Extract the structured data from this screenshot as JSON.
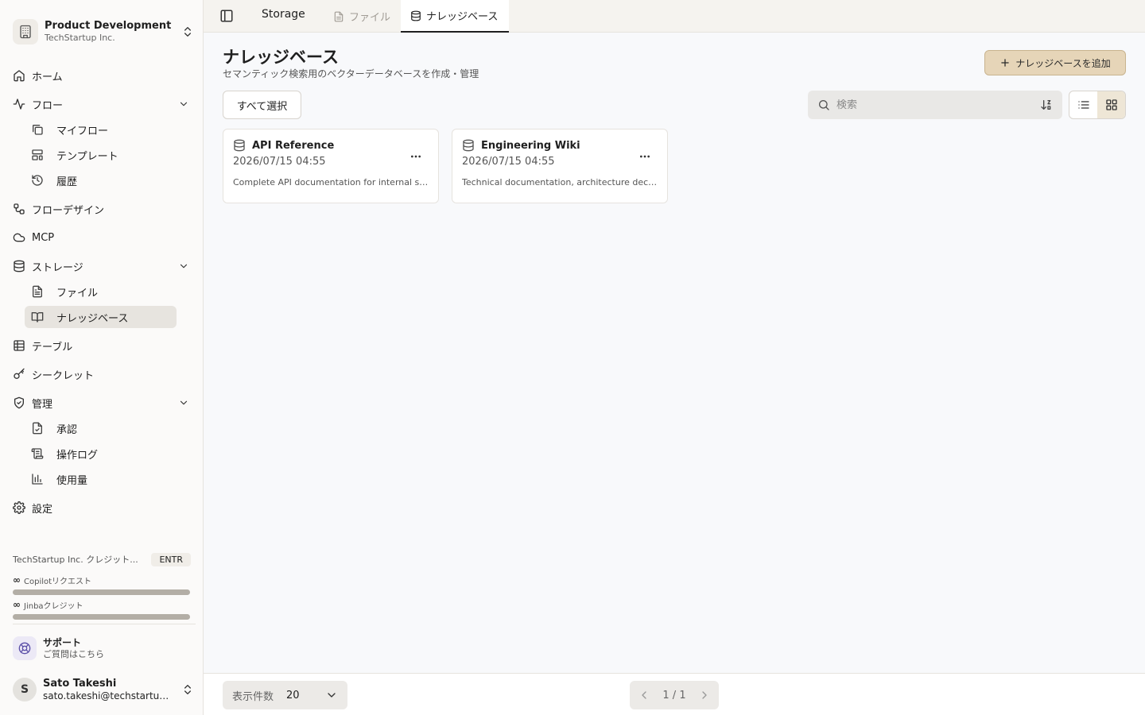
{
  "workspace": {
    "name": "Product Development",
    "org": "TechStartup Inc."
  },
  "nav": {
    "home": "ホーム",
    "flow": "フロー",
    "flow_children": {
      "my_flow": "マイフロー",
      "templates": "テンプレート",
      "history": "履歴"
    },
    "flow_design": "フローデザイン",
    "mcp": "MCP",
    "storage": "ストレージ",
    "storage_children": {
      "files": "ファイル",
      "knowledge_base": "ナレッジベース"
    },
    "table": "テーブル",
    "secret": "シークレット",
    "admin": "管理",
    "admin_children": {
      "approval": "承認",
      "operation_log": "操作ログ",
      "usage": "使用量"
    },
    "settings": "設定"
  },
  "credits": {
    "title": "TechStartup Inc. クレジット...",
    "plan": "ENTR",
    "items": [
      {
        "symbol": "∞",
        "label": "Copilotリクエスト",
        "progress": 1.0
      },
      {
        "symbol": "∞",
        "label": "Jinbaクレジット",
        "progress": 1.0
      }
    ]
  },
  "support": {
    "title": "サポート",
    "subtitle": "ご質問はこちら"
  },
  "user": {
    "initial": "S",
    "name": "Sato Takeshi",
    "email": "sato.takeshi@techstartup.com"
  },
  "topbar": {
    "breadcrumb": "Storage",
    "tabs": [
      {
        "label": "ファイル",
        "icon": "file-icon",
        "active": false
      },
      {
        "label": "ナレッジベース",
        "icon": "database-icon",
        "active": true
      }
    ]
  },
  "page": {
    "title": "ナレッジベース",
    "subtitle": "セマンティック検索用のベクターデータベースを作成・管理",
    "add_button": "ナレッジベースを追加",
    "select_all": "すべて選択",
    "search_placeholder": "検索"
  },
  "knowledge_bases": [
    {
      "name": "API Reference",
      "date": "2026/07/15 04:55",
      "description": "Complete API documentation for internal services and endpoints"
    },
    {
      "name": "Engineering Wiki",
      "date": "2026/07/15 04:55",
      "description": "Technical documentation, architecture decisions and guides"
    }
  ],
  "footer": {
    "per_page_label": "表示件数",
    "per_page_value": "20",
    "pagination": "1 / 1"
  }
}
